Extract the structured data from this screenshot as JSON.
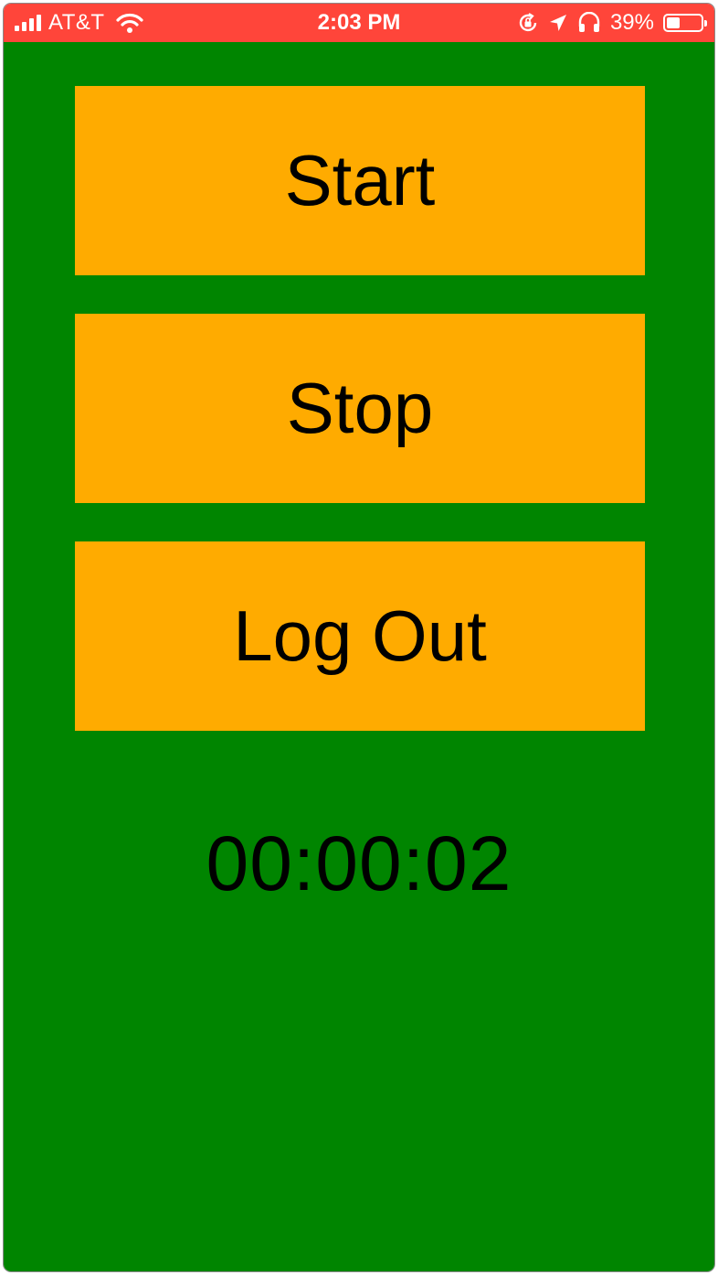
{
  "status_bar": {
    "carrier": "AT&T",
    "time": "2:03 PM",
    "battery_percent": "39%",
    "battery_level": 0.39,
    "color": "#ff453a",
    "icons": [
      "signal-bars-icon",
      "wifi-icon",
      "orientation-lock-icon",
      "location-arrow-icon",
      "headphones-icon",
      "battery-icon"
    ]
  },
  "screen": {
    "background": "#008500",
    "button_color": "#ffab00"
  },
  "buttons": {
    "start_label": "Start",
    "stop_label": "Stop",
    "logout_label": "Log Out"
  },
  "timer": {
    "value": "00:00:02"
  }
}
